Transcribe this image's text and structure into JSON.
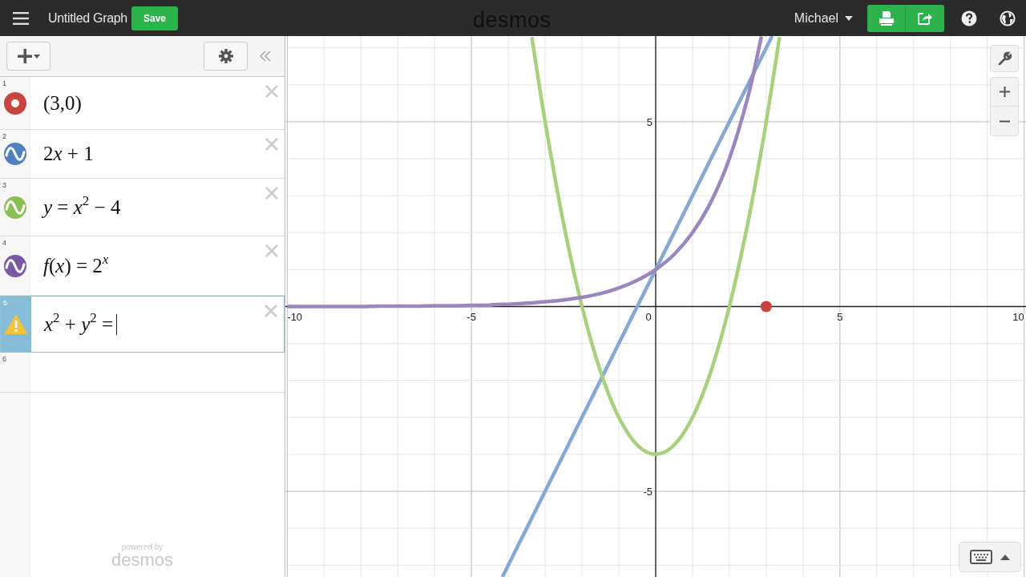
{
  "header": {
    "graph_title": "Untitled Graph",
    "save": "Save",
    "logo": "desmos",
    "user": "Michael"
  },
  "expressions": [
    {
      "number": "1",
      "kind": "point",
      "color": "#c74440",
      "selected": false,
      "focused": false,
      "math": [
        {
          "text": "(3,0)",
          "italic": false,
          "raised": false
        }
      ]
    },
    {
      "number": "2",
      "kind": "curve",
      "color": "#4f81c0",
      "selected": false,
      "focused": false,
      "math": [
        {
          "text": "2",
          "italic": false,
          "raised": false
        },
        {
          "text": "x",
          "italic": true,
          "raised": false
        },
        {
          "text": " + 1",
          "italic": false,
          "raised": false
        }
      ]
    },
    {
      "number": "3",
      "kind": "curve",
      "color": "#8bbf56",
      "selected": false,
      "focused": false,
      "math": [
        {
          "text": "y",
          "italic": true,
          "raised": false
        },
        {
          "text": " = ",
          "italic": false,
          "raised": false
        },
        {
          "text": "x",
          "italic": true,
          "raised": false
        },
        {
          "text": "2",
          "italic": false,
          "raised": true
        },
        {
          "text": " − 4",
          "italic": false,
          "raised": false
        }
      ]
    },
    {
      "number": "4",
      "kind": "curve",
      "color": "#7a58a6",
      "selected": false,
      "focused": false,
      "math": [
        {
          "text": "f",
          "italic": true,
          "raised": false
        },
        {
          "text": "(",
          "italic": false,
          "raised": false
        },
        {
          "text": "x",
          "italic": true,
          "raised": false
        },
        {
          "text": ") = 2",
          "italic": false,
          "raised": false
        },
        {
          "text": "x",
          "italic": true,
          "raised": true
        }
      ]
    },
    {
      "number": "5",
      "kind": "error",
      "color": "#f5c33b",
      "selected": true,
      "focused": true,
      "math": [
        {
          "text": "x",
          "italic": true,
          "raised": false
        },
        {
          "text": "2",
          "italic": false,
          "raised": true
        },
        {
          "text": " + ",
          "italic": false,
          "raised": false
        },
        {
          "text": "y",
          "italic": true,
          "raised": false
        },
        {
          "text": "2",
          "italic": false,
          "raised": true
        },
        {
          "text": " =",
          "italic": false,
          "raised": false
        }
      ]
    },
    {
      "number": "6",
      "kind": "empty",
      "selected": false,
      "focused": false
    }
  ],
  "powered_by": "powered by",
  "powered_logo": "desmos",
  "graph": {
    "chart_data": {
      "type": "line",
      "grid": true,
      "xlim": [
        -10.05,
        10.05
      ],
      "ylim": [
        -7.32,
        7.32
      ],
      "xticks": [
        {
          "value": -10,
          "label": "-10"
        },
        {
          "value": -5,
          "label": "-5"
        },
        {
          "value": 0,
          "label": "0"
        },
        {
          "value": 5,
          "label": "5"
        },
        {
          "value": 10,
          "label": "10"
        }
      ],
      "yticks": [
        {
          "value": -5,
          "label": "-5"
        },
        {
          "value": 5,
          "label": "5"
        }
      ],
      "x": [
        -10,
        -9.5,
        -9,
        -8.5,
        -8,
        -7.5,
        -7,
        -6.5,
        -6,
        -5.5,
        -5,
        -4.5,
        -4.16,
        -4,
        -3.5,
        -3.36,
        -3,
        -2.5,
        -2,
        -1.5,
        -1,
        -0.5,
        0,
        0.5,
        1,
        1.5,
        2,
        2.5,
        2.87,
        3,
        3.16,
        3.36
      ],
      "series": [
        {
          "color": "#85a8d4",
          "marker": false,
          "values": [
            null,
            null,
            null,
            null,
            null,
            null,
            null,
            null,
            null,
            null,
            null,
            null,
            -7.32,
            -7,
            -6,
            -5.72,
            -5,
            -4,
            -3,
            -2,
            -1,
            0,
            1,
            2,
            3,
            4,
            5,
            6,
            6.74,
            7,
            7.32,
            null
          ]
        },
        {
          "color": "#a9d07d",
          "marker": false,
          "values": [
            null,
            null,
            null,
            null,
            null,
            null,
            null,
            null,
            null,
            null,
            null,
            null,
            null,
            null,
            null,
            7.29,
            5,
            2.25,
            0,
            -1.75,
            -3,
            -3.75,
            -4,
            -3.75,
            -3,
            -1.75,
            0,
            2.25,
            4.24,
            5,
            5.99,
            7.29
          ]
        },
        {
          "color": "#9c86be",
          "marker": false,
          "values": [
            0,
            0,
            0,
            0,
            0,
            0.01,
            0.01,
            0.01,
            0.02,
            0.02,
            0.03,
            0.04,
            0.06,
            0.06,
            0.09,
            0.1,
            0.13,
            0.18,
            0.25,
            0.35,
            0.5,
            0.71,
            1,
            1.41,
            2,
            2.83,
            4,
            5.66,
            7.31,
            null,
            null,
            null
          ]
        },
        {
          "color": "#c74440",
          "marker": true,
          "values": [
            null,
            null,
            null,
            null,
            null,
            null,
            null,
            null,
            null,
            null,
            null,
            null,
            null,
            null,
            null,
            null,
            null,
            null,
            null,
            null,
            null,
            null,
            null,
            null,
            null,
            null,
            null,
            null,
            null,
            0,
            null,
            null
          ]
        }
      ]
    }
  }
}
